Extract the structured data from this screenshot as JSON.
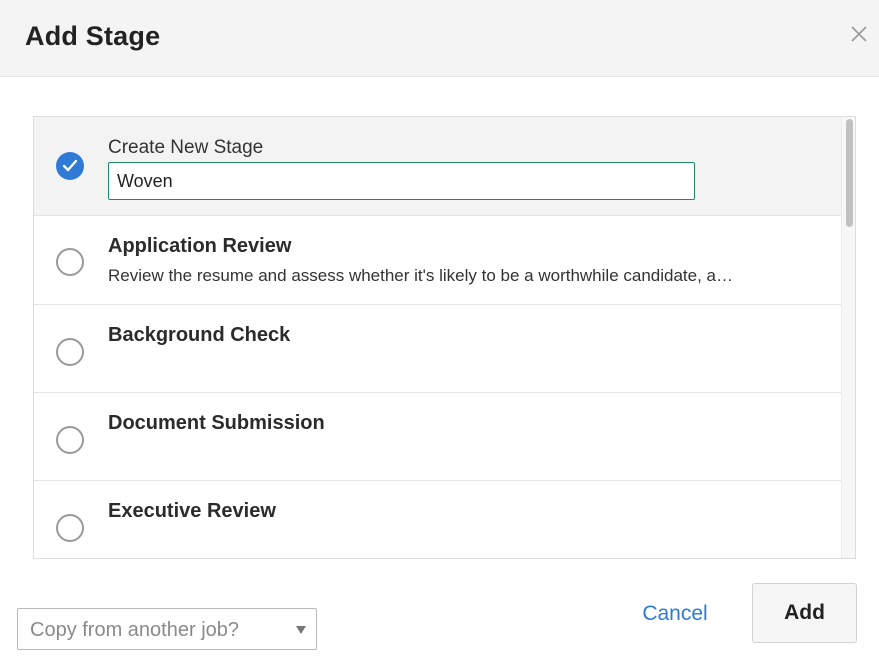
{
  "dialog": {
    "title": "Add Stage",
    "close_icon": "close-icon"
  },
  "stage_list": {
    "create_new": {
      "label": "Create New Stage",
      "input_value": "Woven",
      "selected": true
    },
    "stages": [
      {
        "name": "Application Review",
        "description": "Review the resume and assess whether it's likely to be a worthwhile candidate, a…",
        "selected": false
      },
      {
        "name": "Background Check",
        "description": "",
        "selected": false
      },
      {
        "name": "Document Submission",
        "description": "",
        "selected": false
      },
      {
        "name": "Executive Review",
        "description": "",
        "selected": false
      }
    ]
  },
  "footer": {
    "copy_select": {
      "placeholder": "Copy from another job?"
    },
    "cancel_label": "Cancel",
    "add_label": "Add"
  },
  "colors": {
    "accent": "#2f7ad4",
    "input_border": "#1f8a6a",
    "header_bg": "#f4f4f4"
  }
}
